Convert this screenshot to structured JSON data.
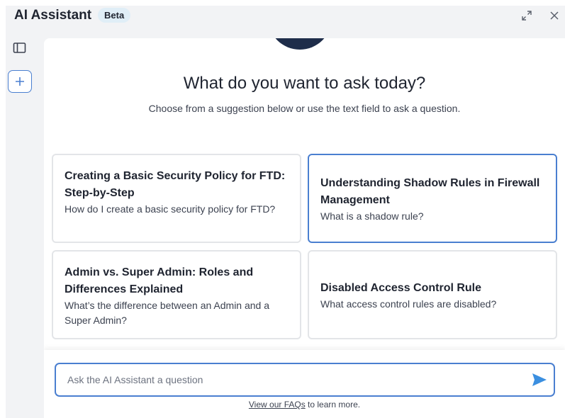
{
  "header": {
    "title": "AI Assistant",
    "badge": "Beta",
    "expand_icon": "expand-icon",
    "close_icon": "close-icon"
  },
  "sidebar": {
    "toggle_icon": "sidebar-panel-icon",
    "new_chat_icon": "plus-icon"
  },
  "main": {
    "heading": "What do you want to ask today?",
    "subheading": "Choose from a suggestion below or use the text field to ask a question.",
    "suggestions": [
      {
        "title": "Creating a Basic Security Policy for FTD: Step-by-Step",
        "description": "How do I create a basic security policy for FTD?"
      },
      {
        "title": "Understanding Shadow Rules in Firewall Management",
        "description": "What is a shadow rule?"
      },
      {
        "title": "Admin vs. Super Admin: Roles and Differences Explained",
        "description": "What’s the difference between an Admin and a Super Admin?"
      },
      {
        "title": "Disabled Access Control Rule",
        "description": "What access control rules are disabled?"
      }
    ]
  },
  "composer": {
    "placeholder": "Ask the AI Assistant a question",
    "value": "",
    "send_icon": "send-icon",
    "faq_link": "View our FAQs",
    "faq_suffix": "to learn more."
  },
  "colors": {
    "accent": "#4a7fd0",
    "send": "#3b8fe0",
    "badge_bg": "#e0eef7",
    "avatar": "#1e2d4a"
  }
}
